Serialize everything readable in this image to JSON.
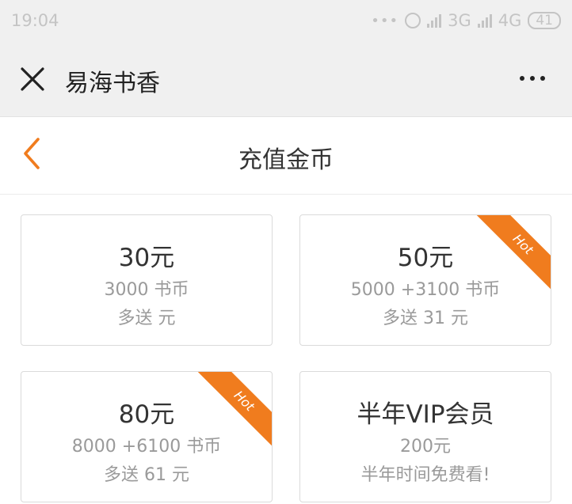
{
  "status_bar": {
    "time": "19:04",
    "dots": "•••",
    "network_3g": "3G",
    "network_4g": "4G",
    "battery": "41"
  },
  "app_bar": {
    "title": "易海书香"
  },
  "page_header": {
    "title": "充值金币"
  },
  "accent_color": "#f07c1e",
  "cards": [
    {
      "price": "30元",
      "coins": "3000 书币",
      "bonus": "多送 元",
      "hot": false
    },
    {
      "price": "50元",
      "coins": "5000 +3100 书币",
      "bonus": "多送 31 元",
      "hot": true,
      "hot_label": "Hot"
    },
    {
      "price": "80元",
      "coins": "8000 +6100 书币",
      "bonus": "多送 61 元",
      "hot": true,
      "hot_label": "Hot"
    },
    {
      "price": "半年VIP会员",
      "coins": "200元",
      "bonus": "半年时间免费看!",
      "hot": false
    }
  ]
}
